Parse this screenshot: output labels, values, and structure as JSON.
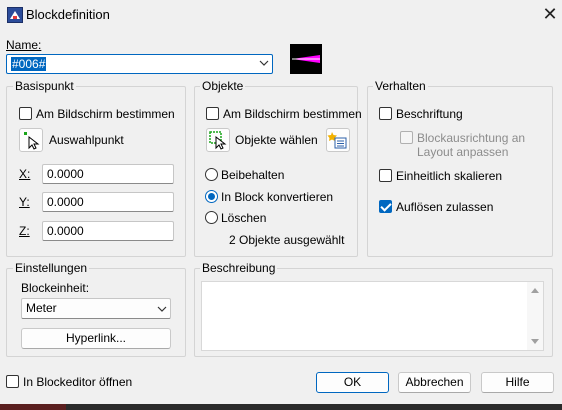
{
  "window": {
    "title": "Blockdefinition",
    "close_glyph": "✕"
  },
  "name": {
    "label": "Name:",
    "value": "#006#"
  },
  "basepoint": {
    "title": "Basispunkt",
    "on_screen_label": "Am Bildschirm bestimmen",
    "pick_label": "Auswahlpunkt",
    "x_label": "X:",
    "x_value": "0.0000",
    "y_label": "Y:",
    "y_value": "0.0000",
    "z_label": "Z:",
    "z_value": "0.0000"
  },
  "objects": {
    "title": "Objekte",
    "on_screen_label": "Am Bildschirm bestimmen",
    "select_label": "Objekte wählen",
    "retain_label": "Beibehalten",
    "convert_label": "In Block konvertieren",
    "delete_label": "Löschen",
    "selected_option": "In Block konvertieren",
    "status": "2 Objekte ausgewählt"
  },
  "behavior": {
    "title": "Verhalten",
    "annotative_label": "Beschriftung",
    "orientation_label_1": "Blockausrichtung an",
    "orientation_label_2": "Layout anpassen",
    "uniform_label": "Einheitlich skalieren",
    "explode_label": "Auflösen zulassen",
    "explode_checked": true
  },
  "settings": {
    "title": "Einstellungen",
    "unit_label": "Blockeinheit:",
    "unit_value": "Meter",
    "hyperlink_label": "Hyperlink..."
  },
  "description": {
    "title": "Beschreibung",
    "value": ""
  },
  "footer": {
    "open_editor_label": "In Blockeditor öffnen",
    "ok_label": "OK",
    "cancel_label": "Abbrechen",
    "help_label": "Hilfe"
  },
  "colors": {
    "accent": "#0067c0",
    "preview_bg": "#000000",
    "preview_line": "#ff00ff"
  }
}
